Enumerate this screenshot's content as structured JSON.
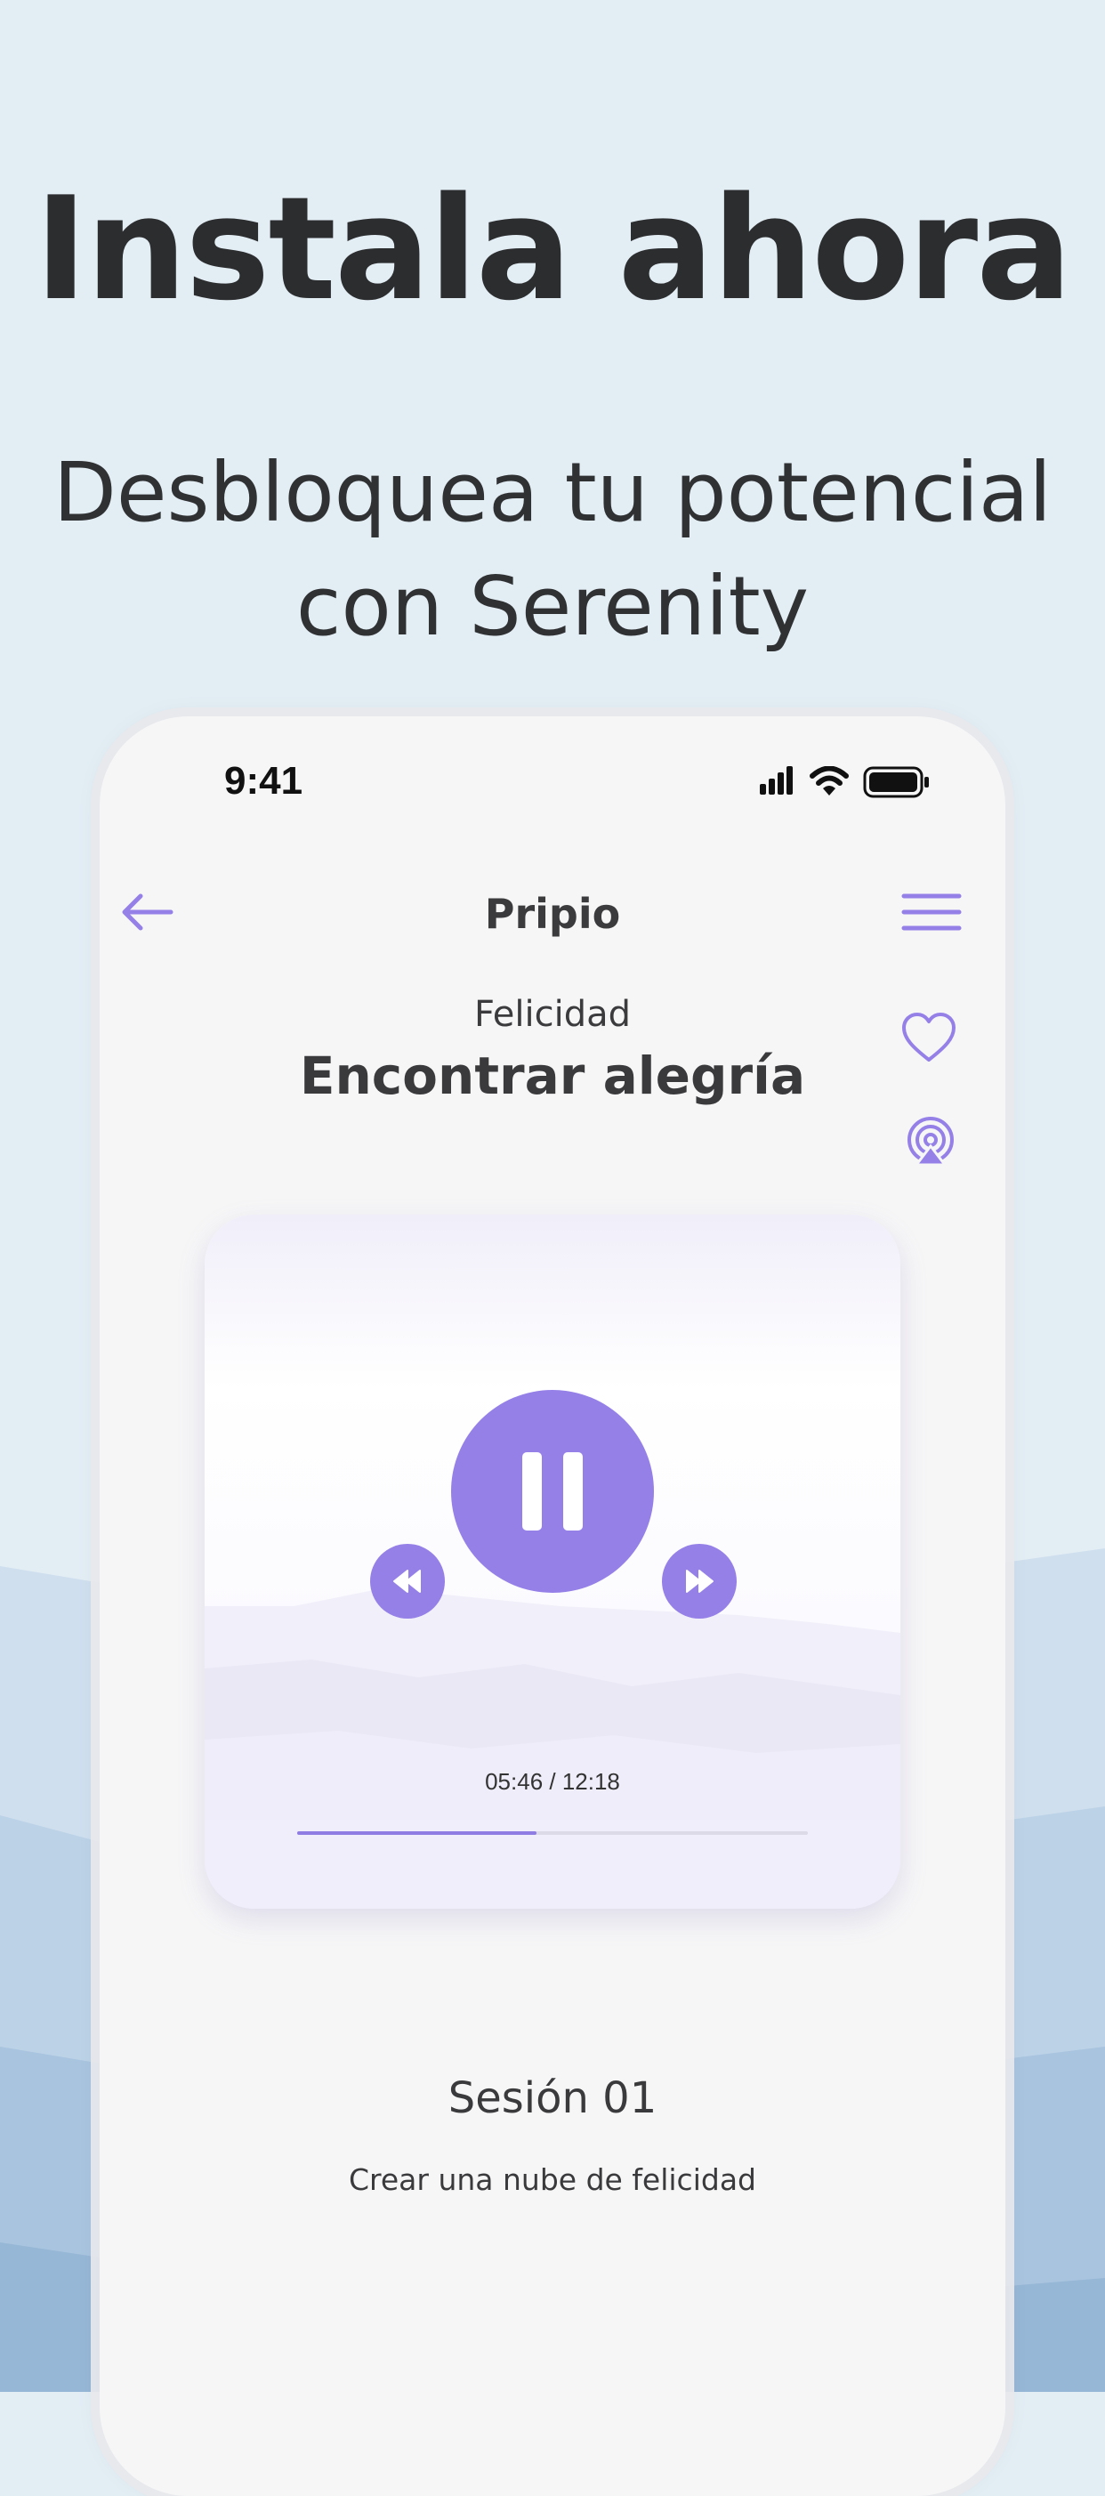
{
  "promo": {
    "headline": "Instala ahora",
    "subline_1": "Desbloquea tu potencial",
    "subline_2": "con Serenity"
  },
  "status_bar": {
    "time": "9:41",
    "icons": [
      "cellular-signal-icon",
      "wifi-icon",
      "battery-icon"
    ]
  },
  "nav": {
    "title": "Pripio",
    "back_icon": "arrow-left-icon",
    "menu_icon": "hamburger-menu-icon"
  },
  "track": {
    "category": "Felicidad",
    "title": "Encontrar alegría",
    "actions": [
      "heart-icon",
      "airplay-icon"
    ]
  },
  "player": {
    "elapsed": "05:46",
    "duration": "12:18",
    "time_label": "05:46 / 12:18",
    "progress_fraction": 0.469,
    "controls": [
      "rewind-icon",
      "pause-icon",
      "fast-forward-icon"
    ]
  },
  "session": {
    "title": "Sesión 01",
    "subtitle": "Crear una nube de felicidad"
  },
  "colors": {
    "accent": "#9580e8",
    "background": "#e3edf4",
    "phone_surface": "#f6f6f7",
    "text_dark": "#2b2d2f"
  }
}
